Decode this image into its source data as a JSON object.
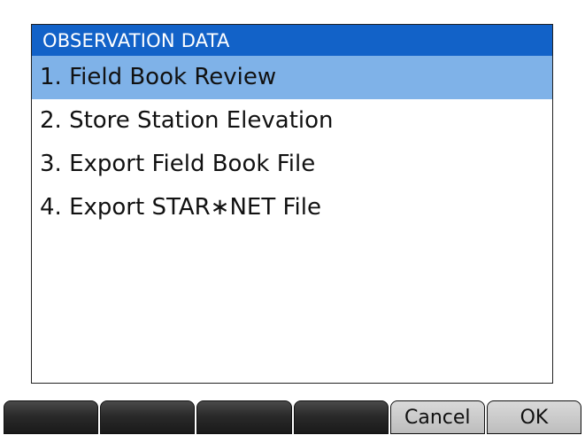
{
  "dialog": {
    "title": "OBSERVATION DATA",
    "items": [
      {
        "label": "1. Field Book Review",
        "selected": true
      },
      {
        "label": "2. Store Station Elevation",
        "selected": false
      },
      {
        "label": "3. Export Field Book File",
        "selected": false
      },
      {
        "label": "4. Export STAR∗NET File",
        "selected": false
      }
    ]
  },
  "softkeys": {
    "key1": "",
    "key2": "",
    "key3": "",
    "key4": "",
    "cancel": "Cancel",
    "ok": "OK"
  },
  "colors": {
    "title_bar": "#1262c8",
    "selection": "#7fb2e8"
  }
}
